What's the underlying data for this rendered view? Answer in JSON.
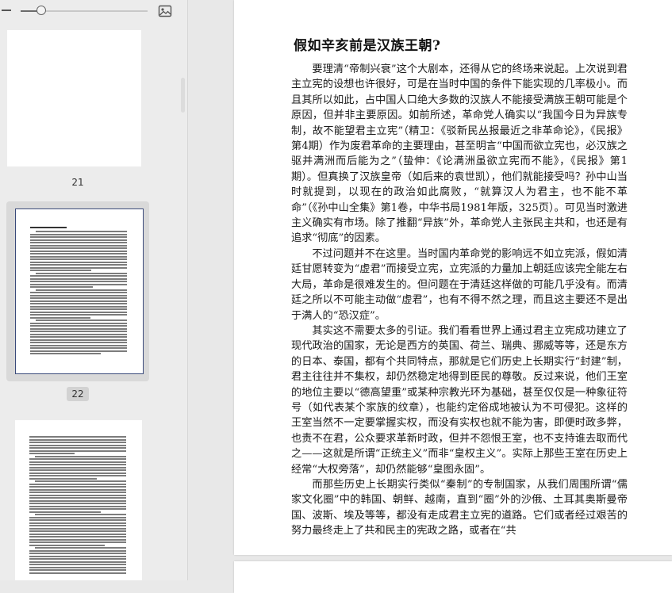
{
  "toolbar": {
    "zoom_out_icon": "minus-icon",
    "zoom_level": 0.16,
    "image_icon": "image-icon"
  },
  "thumbnails": [
    {
      "page": "21",
      "selected": false
    },
    {
      "page": "22",
      "selected": true
    },
    {
      "page": "",
      "selected": false
    }
  ],
  "document": {
    "title": "假如辛亥前是汉族王朝?",
    "paragraphs": [
      "要理清“帝制兴衰”这个大剧本，还得从它的终场来说起。上次说到君主立宪的设想也许很好，可是在当时中国的条件下能实现的几率极小。而且其所以如此，占中国人口绝大多数的汉族人不能接受满族王朝可能是个原因，但并非主要原因。如前所述，革命党人确实以“我国今日为异族专制，故不能望君主立宪”（精卫：《驳新民丛报最近之非革命论》，《民报》第4期）作为废君革命的主要理由，甚至明言“中国而欲立宪也，必汉族之驱并满洲而后能为之”（蛰伸：《论满洲虽欲立宪而不能》，《民报》第1期）。但真换了汉族皇帝（如后来的袁世凯），他们就能接受吗？孙中山当时就提到，以现在的政治如此腐败，“就算汉人为君主，也不能不革命”（《孙中山全集》第1卷，中华书局1981年版，325页）。可见当时激进主义确实有市场。除了推翻“异族”外，革命党人主张民主共和，也还是有追求“彻底”的因素。",
      "不过问题并不在这里。当时国内革命党的影响远不如立宪派，假如清廷甘愿转变为“虚君”而接受立宪，立宪派的力量加上朝廷应该完全能左右大局，革命是很难发生的。但问题在于清廷这样做的可能几乎没有。而清廷之所以不可能主动做“虚君”，也有不得不然之理，而且这主要还不是出于满人的“恐汉症”。",
      "其实这不需要太多的引证。我们看看世界上通过君主立宪成功建立了现代政治的国家，无论是西方的英国、荷兰、瑞典、挪威等等，还是东方的日本、泰国，都有个共同特点，那就是它们历史上长期实行“封建”制，君主往往并不集权，却仍然稳定地得到臣民的尊敬。反过来说，他们王室的地位主要以“德高望重”或某种宗教光环为基础，甚至仅仅是一种象征符号（如代表某个家族的纹章），也能约定俗成地被认为不可侵犯。这样的王室当然不一定要掌握实权，而没有实权也就不能为害，即便时政多弊，也责不在君，公众要求革新时政，但并不怨恨王室，也不支持谁去取而代之——这就是所谓“正统主义”而非“皇权主义”。实际上那些王室在历史上经常“大权旁落”，却仍然能够“皇图永固”。",
      "而那些历史上长期实行类似“秦制”的专制国家，从我们周围所谓“儒家文化圈”中的韩国、朝鲜、越南，直到“圈”外的沙俄、土耳其奥斯曼帝国、波斯、埃及等等，都没有走成君主立宪的道路。它们或者经过艰苦的努力最终走上了共和民主的宪政之路，或者在“共"
    ]
  }
}
